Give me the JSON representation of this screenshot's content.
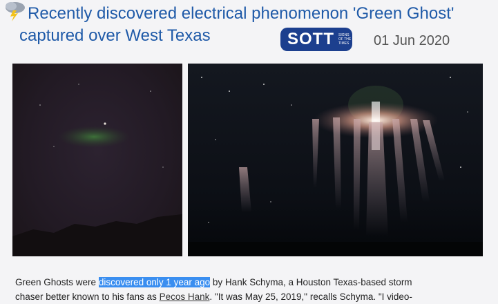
{
  "headline": {
    "icon": "storm-cloud-icon",
    "title_line1": "Recently discovered electrical phenomenon 'Green Ghost'",
    "title_line2": "captured over West Texas"
  },
  "source": {
    "logo_text": "SOTT",
    "logo_small_text": "SIGNS OF THE TIMES",
    "date": "01 Jun 2020"
  },
  "images": {
    "left": "green-ghost-photo",
    "right": "red-sprite-photo"
  },
  "article": {
    "line1_before": "Green Ghosts were ",
    "line1_highlight": "discovered only 1 year ago",
    "line1_after": " by Hank Schyma, a Houston Texas-based storm",
    "line2_before": "chaser better known to his fans as ",
    "line2_link": "Pecos Hank",
    "line2_after": ". \"It was May 25, 2019,\" recalls Schyma. \"I video-"
  },
  "colors": {
    "title": "#1f5aa8",
    "badge": "#1c3f8e",
    "highlight": "#3a8ef0",
    "background": "#f4f4f6"
  }
}
